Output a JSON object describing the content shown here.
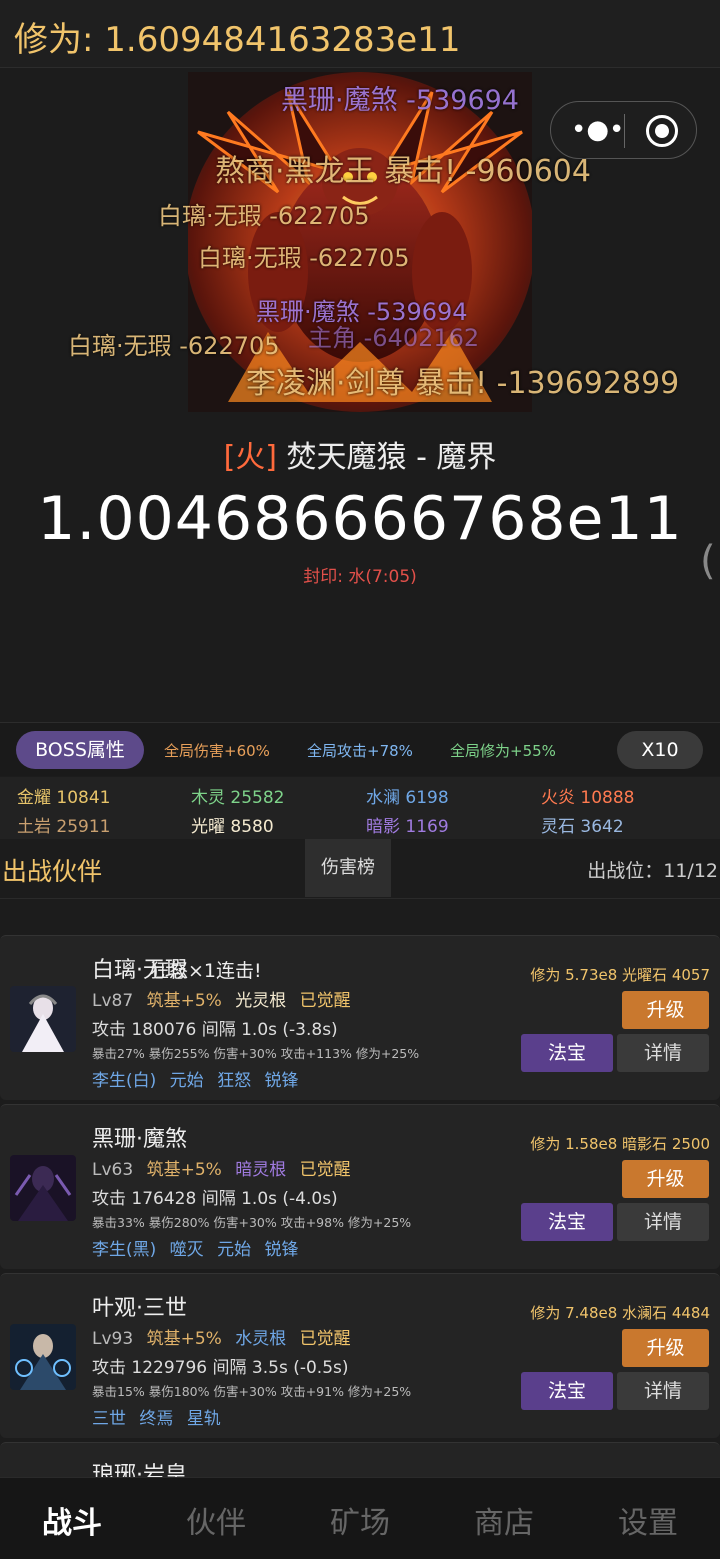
{
  "header": {
    "cultivation": "修为: 1.609484163283e11"
  },
  "capsule": {
    "more_icon": "more-dots-icon",
    "close_icon": "target-circle-icon"
  },
  "boss": {
    "element_tag": "[火]",
    "name": "焚天魔猿 - 魔界",
    "hp": "1.004686666768e11",
    "seal": "封印: 水(7:05)"
  },
  "damage_popups": [
    "黑珊·魔煞 -539694",
    "熬商·黑龙王 暴击! -960604",
    "白璃·无瑕 -622705",
    "白璃·无瑕 -622705",
    "黑珊·魔煞 -539694",
    "白璃·无瑕 -622705",
    "主角 -6402162",
    "李凌渊·剑尊 暴击! -139692899"
  ],
  "buffs": {
    "boss_attr_label": "BOSS属性",
    "global_damage": "全局伤害+60%",
    "global_attack": "全局攻击+78%",
    "global_cultivation": "全局修为+55%",
    "multiplier_label": "X10"
  },
  "resources": {
    "gold": "金耀 10841",
    "wood": "木灵 25582",
    "water": "水澜 6198",
    "fire": "火炎 10888",
    "earth": "土岩 25911",
    "light": "光曜 8580",
    "shadow": "暗影 1169",
    "spirit_stone": "灵石 3642"
  },
  "team": {
    "title": "出战伙伴",
    "rank_tab": "伤害榜",
    "slots": "出战位：11/12"
  },
  "cards": [
    {
      "name": "白璃·无瑕",
      "combo": "狂怒×1连击!",
      "level": "Lv87",
      "realm": "筑基+5%",
      "root": "光灵根",
      "awake": "已觉醒",
      "attack": "攻击 180076  间隔 1.0s (-3.8s)",
      "stats": "暴击27% 暴伤255% 伤害+30% 攻击+113% 修为+25%",
      "skills": [
        "李生(白)",
        "元始",
        "狂怒",
        "锐锋"
      ],
      "stock": "修为 5.73e8  光曜石 4057",
      "upgrade": "升级",
      "treasure": "法宝",
      "details": "详情"
    },
    {
      "name": "黑珊·魔煞",
      "combo": "",
      "level": "Lv63",
      "realm": "筑基+5%",
      "root": "暗灵根",
      "awake": "已觉醒",
      "attack": "攻击 176428  间隔 1.0s (-4.0s)",
      "stats": "暴击33% 暴伤280% 伤害+30% 攻击+98% 修为+25%",
      "skills": [
        "李生(黑)",
        "噬灭",
        "元始",
        "锐锋"
      ],
      "stock": "修为 1.58e8  暗影石 2500",
      "upgrade": "升级",
      "treasure": "法宝",
      "details": "详情"
    },
    {
      "name": "叶观·三世",
      "combo": "",
      "level": "Lv93",
      "realm": "筑基+5%",
      "root": "水灵根",
      "awake": "已觉醒",
      "attack": "攻击 1229796  间隔 3.5s (-0.5s)",
      "stats": "暴击15% 暴伤180% 伤害+30% 攻击+91% 修为+25%",
      "skills": [
        "三世",
        "终焉",
        "星轨"
      ],
      "stock": "修为 7.48e8  水澜石 4484",
      "upgrade": "升级",
      "treasure": "法宝",
      "details": "详情"
    },
    {
      "name": "琅琊·岩皇"
    }
  ],
  "tabs": [
    "战斗",
    "伙伴",
    "矿场",
    "商店",
    "设置"
  ]
}
